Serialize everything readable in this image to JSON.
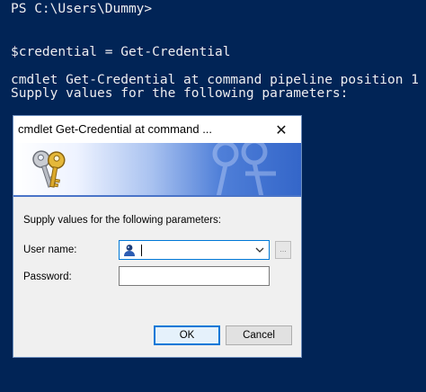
{
  "console": {
    "lines": [
      "PS C:\\Users\\Dummy>",
      "$credential = Get-Credential",
      "cmdlet Get-Credential at command pipeline position 1",
      "Supply values for the following parameters:"
    ],
    "background_color": "#012456",
    "text_color": "#eeedf0"
  },
  "dialog": {
    "title": "cmdlet Get-Credential at command ...",
    "close_glyph": "✕",
    "banner_left_icon": "keys-icon",
    "banner_right_icon": "keys-watermark-icon",
    "prompt": "Supply values for the following parameters:",
    "user_name_label": "User name:",
    "user_name_value": "",
    "user_icon": "user-account-icon",
    "browse_label": "...",
    "password_label": "Password:",
    "password_value": "",
    "ok_label": "OK",
    "cancel_label": "Cancel",
    "accent_color": "#0078d7"
  }
}
